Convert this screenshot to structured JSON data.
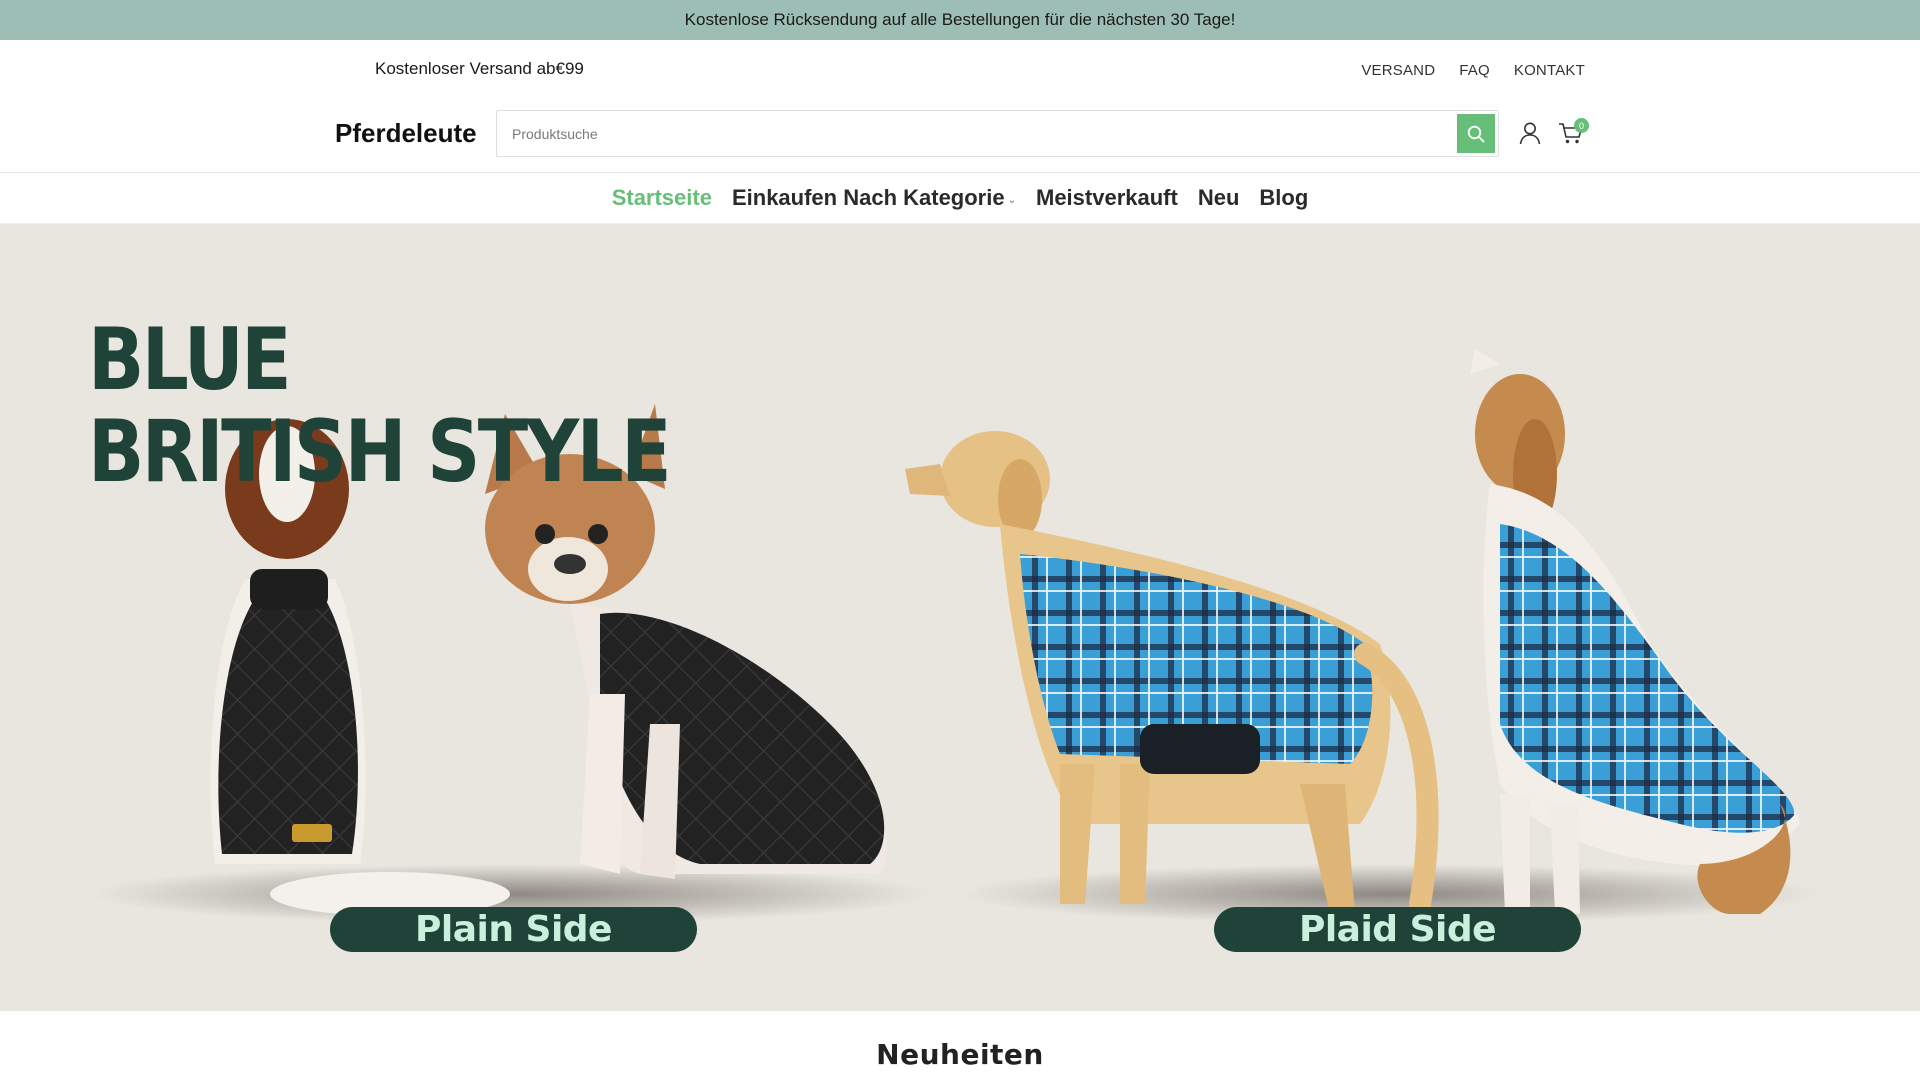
{
  "promo": {
    "text": "Kostenlose Rücksendung auf alle Bestellungen für die nächsten 30 Tage!"
  },
  "header": {
    "shipping_note": "Kostenloser Versand ab€99",
    "links": [
      "VERSAND",
      "FAQ",
      "KONTAKT"
    ],
    "brand": "Pferdeleute",
    "search_placeholder": "Produktsuche",
    "cart_count": "0"
  },
  "nav": {
    "items": [
      "Startseite",
      "Einkaufen Nach Kategorie",
      "Meistverkauft",
      "Neu",
      "Blog"
    ],
    "active": "Startseite"
  },
  "hero": {
    "title_line1": "BLUE",
    "title_line2": "BRITISH STYLE",
    "left_label": "Plain Side",
    "right_label": "Plaid Side"
  },
  "section": {
    "title": "Neuheiten"
  },
  "colors": {
    "accent": "#66be78",
    "promo_bg": "#9dbeb4",
    "hero_bg": "#e9e5df",
    "hero_dark": "#1f4338"
  },
  "icons": {
    "search": "search-icon",
    "user": "user-icon",
    "cart": "cart-icon",
    "dropdown": "chevron-down-icon"
  }
}
